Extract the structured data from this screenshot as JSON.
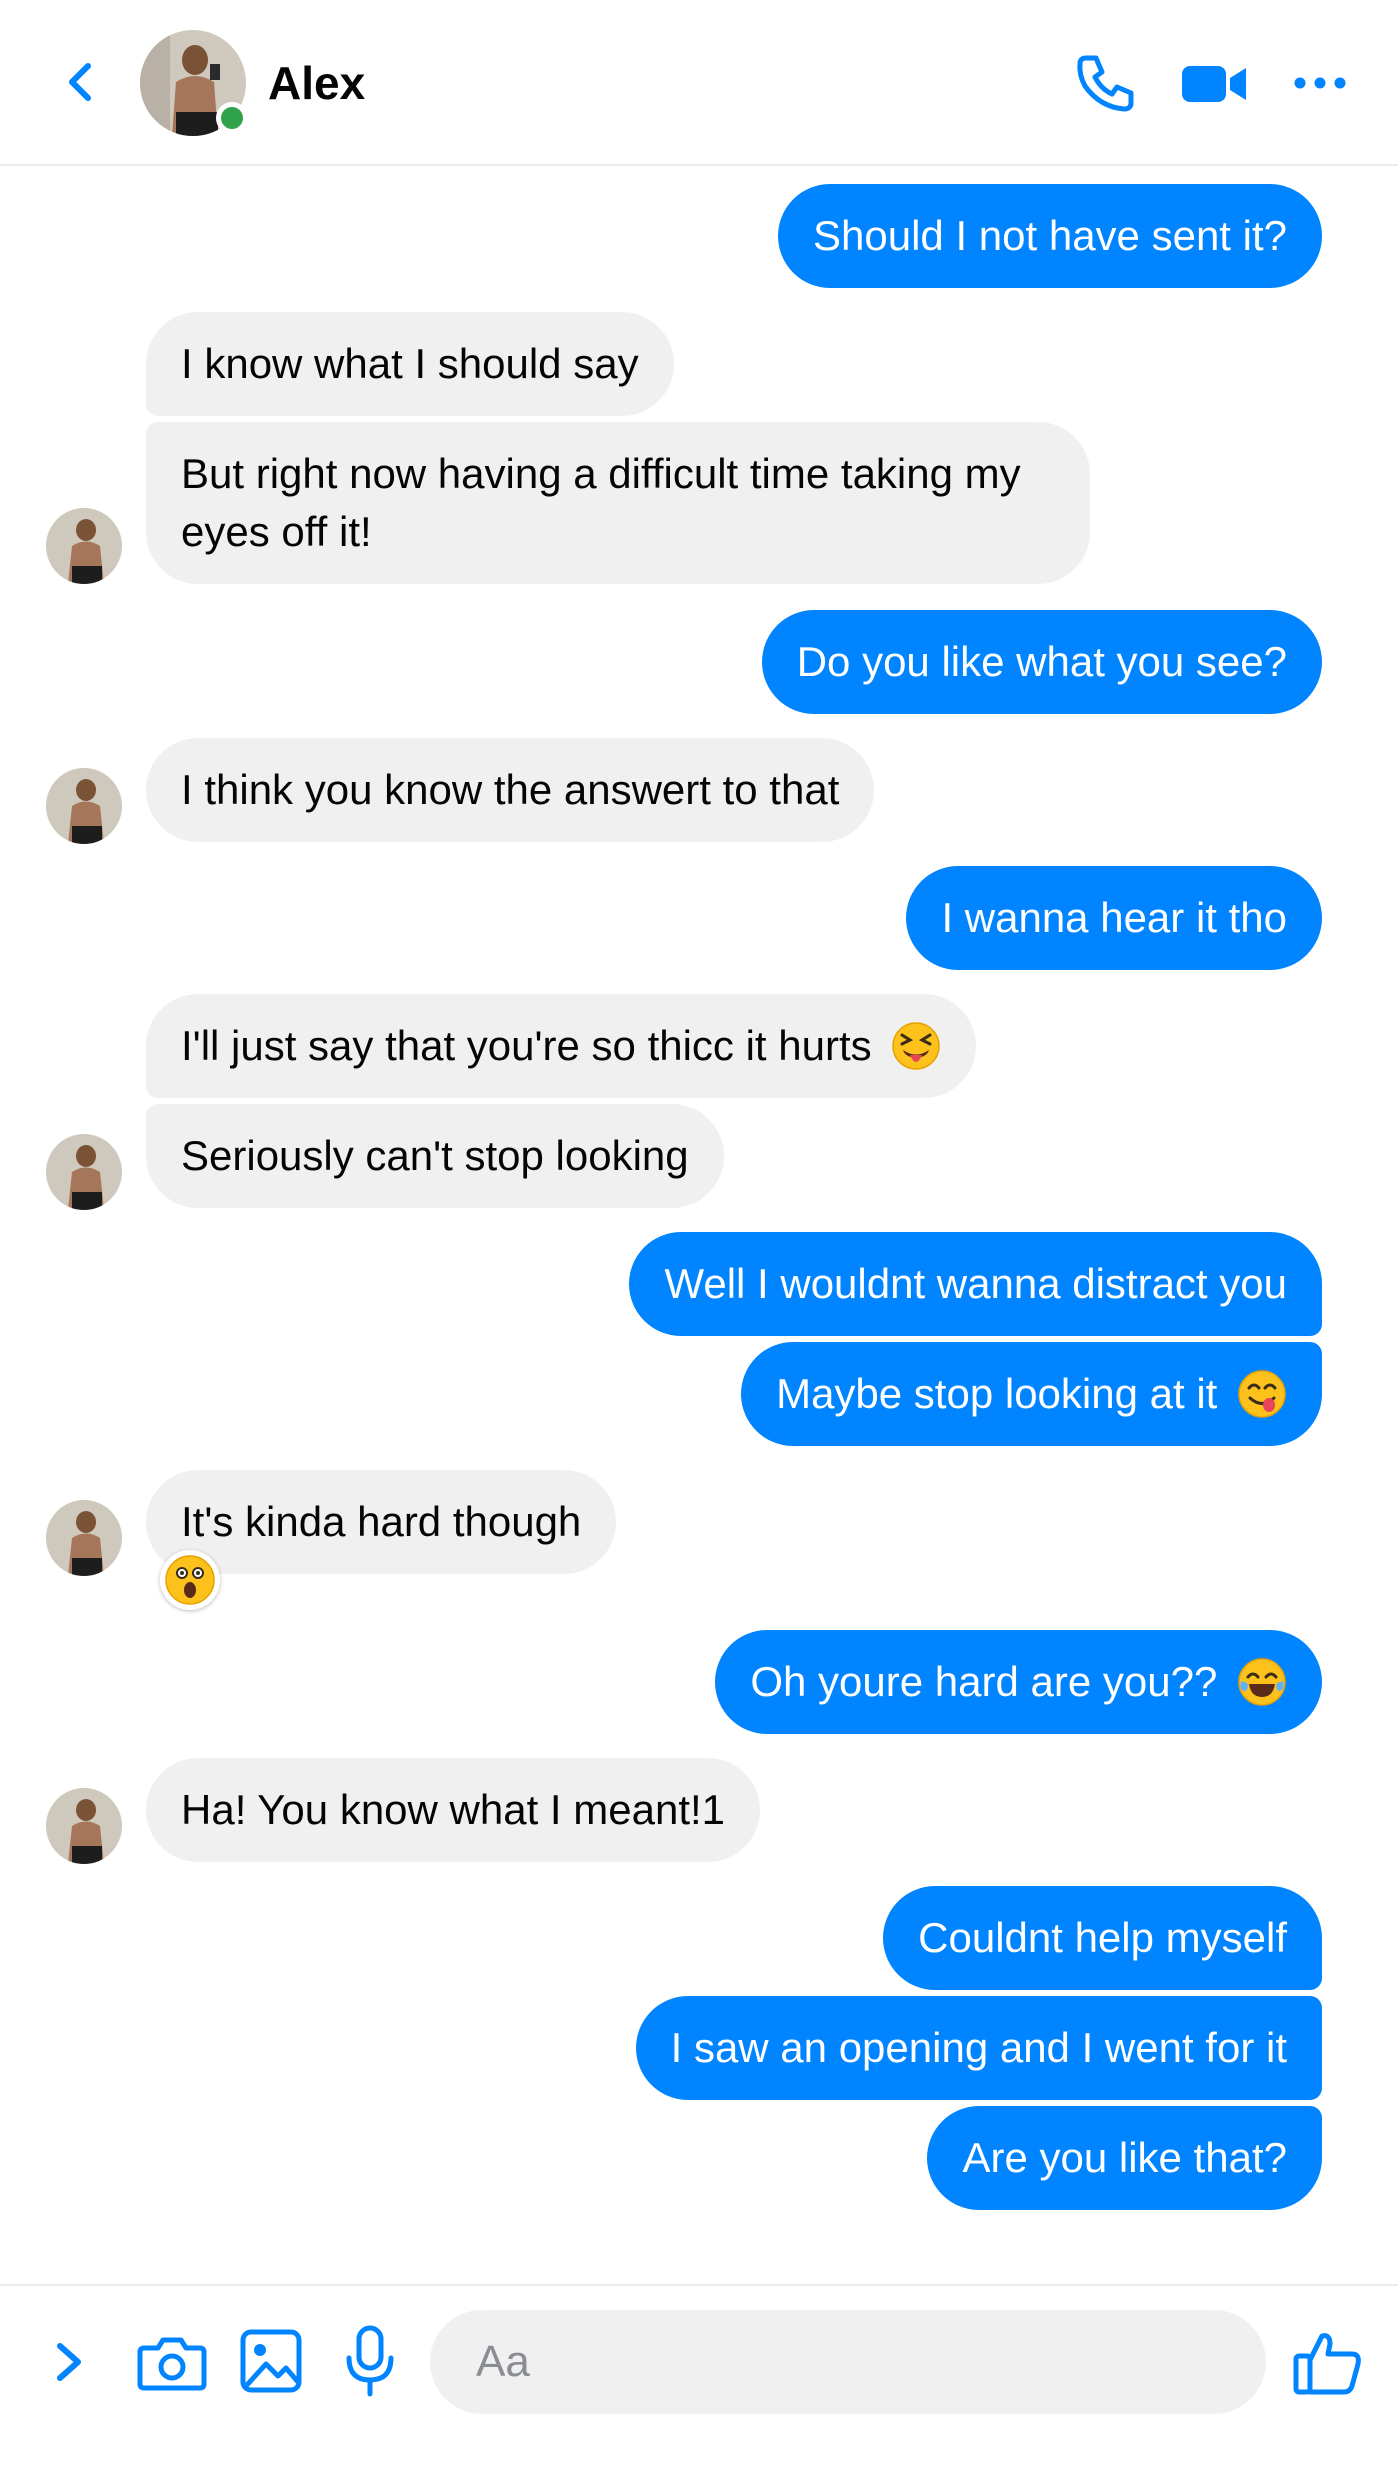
{
  "header": {
    "contact_name": "Alex",
    "back_icon": "chevron-left-icon",
    "icons": [
      "phone-icon",
      "video-camera-icon",
      "more-dots-icon"
    ],
    "online_status_color": "#31a24c"
  },
  "colors": {
    "outgoing_bubble": "#0084ff",
    "incoming_bubble": "#f0f0f0",
    "accent": "#0084ff"
  },
  "messages": [
    {
      "dir": "out",
      "text": "Should I not have sent it?"
    },
    {
      "dir": "in",
      "text": "I know what I should say"
    },
    {
      "dir": "in",
      "text": "But right now having a difficult time taking my eyes off it!"
    },
    {
      "dir": "out",
      "text": "Do you like what you see?"
    },
    {
      "dir": "in",
      "text": "I think you know the answert to that"
    },
    {
      "dir": "out",
      "text": "I wanna hear it tho"
    },
    {
      "dir": "in",
      "text": "I'll just say that you're so thicc it hurts",
      "emoji": "squinting-tongue-emoji"
    },
    {
      "dir": "in",
      "text": "Seriously can't stop looking"
    },
    {
      "dir": "out",
      "text": "Well I wouldnt wanna distract you"
    },
    {
      "dir": "out",
      "text": "Maybe stop looking at it",
      "emoji": "yum-face-emoji"
    },
    {
      "dir": "in",
      "text": "It's kinda hard though",
      "reaction": "astonished-face-emoji"
    },
    {
      "dir": "out",
      "text": "Oh youre hard are you??",
      "emoji": "tears-of-joy-emoji"
    },
    {
      "dir": "in",
      "text": "Ha! You know what I meant!1"
    },
    {
      "dir": "out",
      "text": "Couldnt help myself"
    },
    {
      "dir": "out",
      "text": "I saw an opening and I went for it"
    },
    {
      "dir": "out",
      "text": "Are you like that?"
    }
  ],
  "composer": {
    "placeholder": "Aa",
    "value": "",
    "icons": [
      "chevron-right-icon",
      "camera-icon",
      "image-icon",
      "microphone-icon",
      "thumbs-up-icon"
    ]
  }
}
